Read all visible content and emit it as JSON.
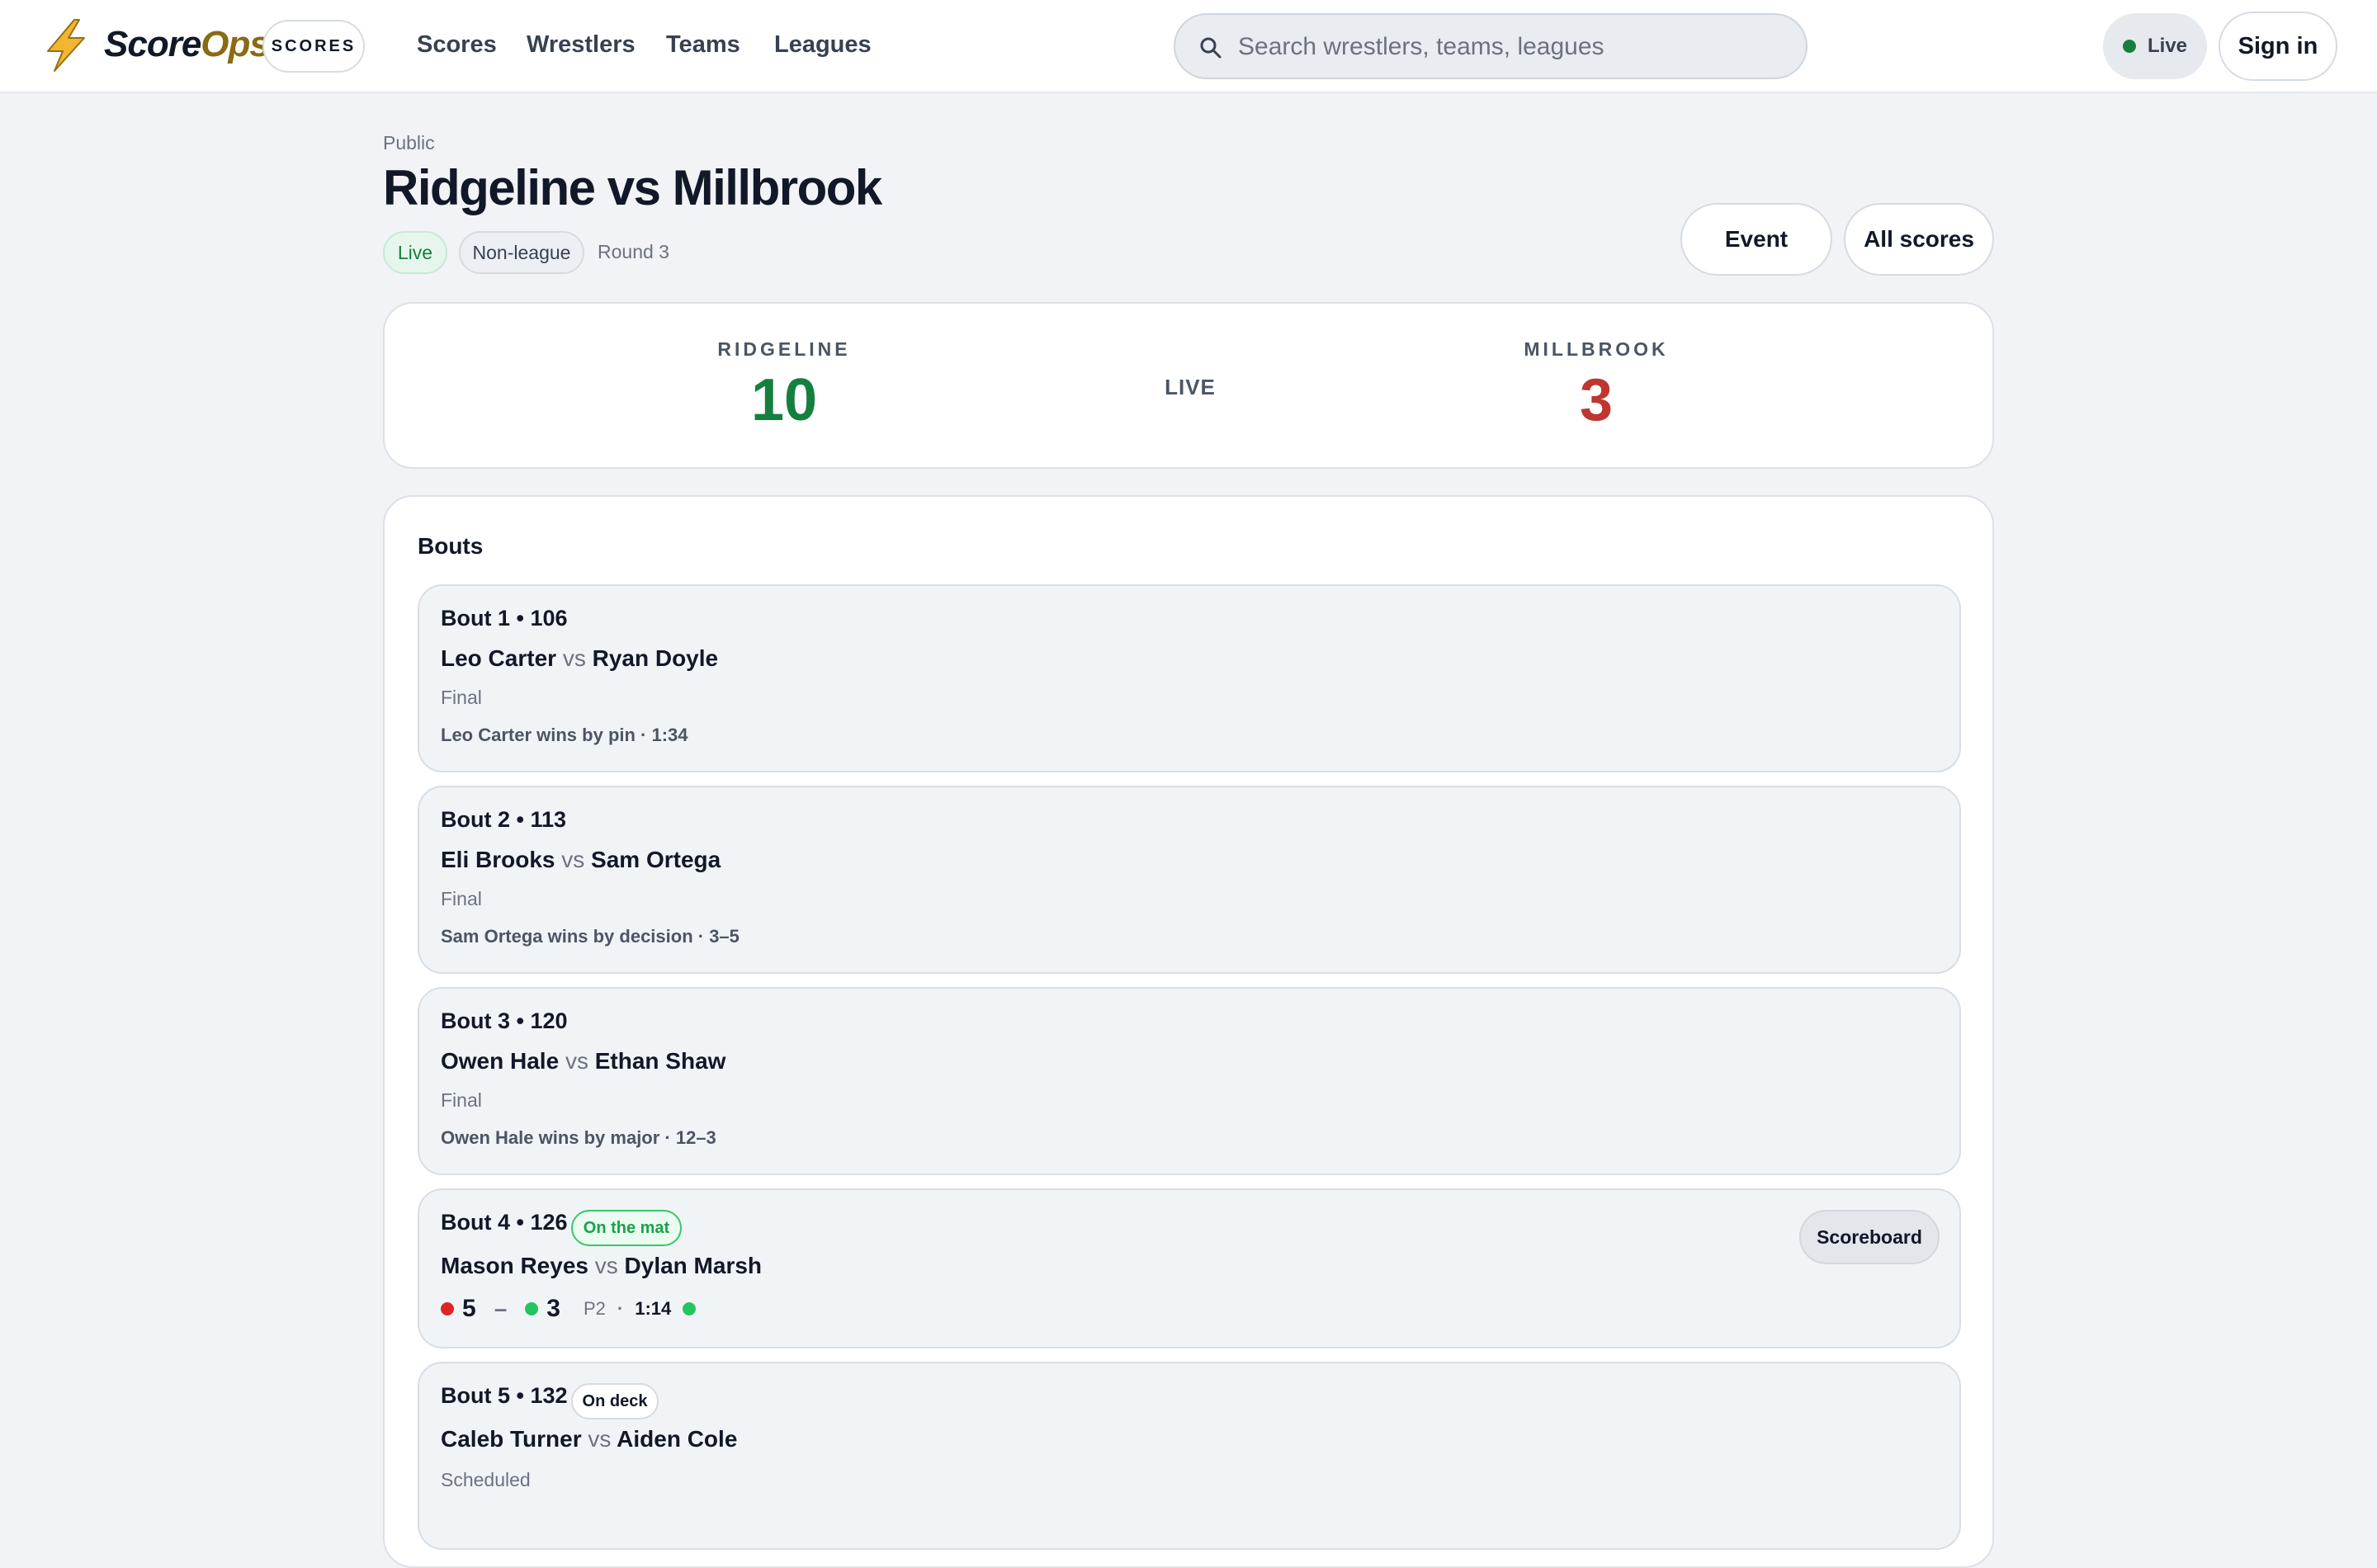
{
  "nav": {
    "brand_score": "Score",
    "brand_ops": "Ops",
    "scores_pill": "SCORES",
    "links": [
      "Scores",
      "Wrestlers",
      "Teams",
      "Leagues"
    ],
    "search_placeholder": "Search wrestlers, teams, leagues",
    "live_label": "Live",
    "signin_label": "Sign in"
  },
  "header": {
    "eyebrow": "Public",
    "title": "Ridgeline vs Millbrook",
    "tags": {
      "live": "Live",
      "league": "Non-league",
      "round": "Round 3"
    },
    "buttons": {
      "event": "Event",
      "all_scores": "All scores"
    }
  },
  "scoreboard": {
    "home": {
      "name": "RIDGELINE",
      "score": "10"
    },
    "away": {
      "name": "MILLBROOK",
      "score": "3"
    },
    "state": "LIVE"
  },
  "bouts": {
    "title": "Bouts",
    "items": [
      {
        "head": "Bout 1 • 106",
        "a": "Leo Carter",
        "vs": "vs",
        "b": "Ryan Doyle",
        "status": "Final",
        "result": "Leo Carter wins by pin · 1:34"
      },
      {
        "head": "Bout 2 • 113",
        "a": "Eli Brooks",
        "vs": "vs",
        "b": "Sam Ortega",
        "status": "Final",
        "result": "Sam Ortega wins by decision · 3–5"
      },
      {
        "head": "Bout 3 • 120",
        "a": "Owen Hale",
        "vs": "vs",
        "b": "Ethan Shaw",
        "status": "Final",
        "result": "Owen Hale wins by major · 12–3"
      },
      {
        "head": "Bout 4 • 126",
        "badge": "On the mat",
        "a": "Mason Reyes",
        "vs": "vs",
        "b": "Dylan Marsh",
        "scoreboard_btn": "Scoreboard",
        "live": {
          "red_points": "5",
          "dash": "–",
          "green_points": "3",
          "period": "P2",
          "sep": "·",
          "clock": "1:14"
        }
      },
      {
        "head": "Bout 5 • 132",
        "badge": "On deck",
        "a": "Caleb Turner",
        "vs": "vs",
        "b": "Aiden Cole",
        "status": "Scheduled"
      }
    ]
  },
  "colors": {
    "accent_green": "#15803d",
    "away_red": "#c0352f",
    "live_green": "#22c55e",
    "red_dot": "#dc2626",
    "brand_gold": "#8a6a12"
  }
}
